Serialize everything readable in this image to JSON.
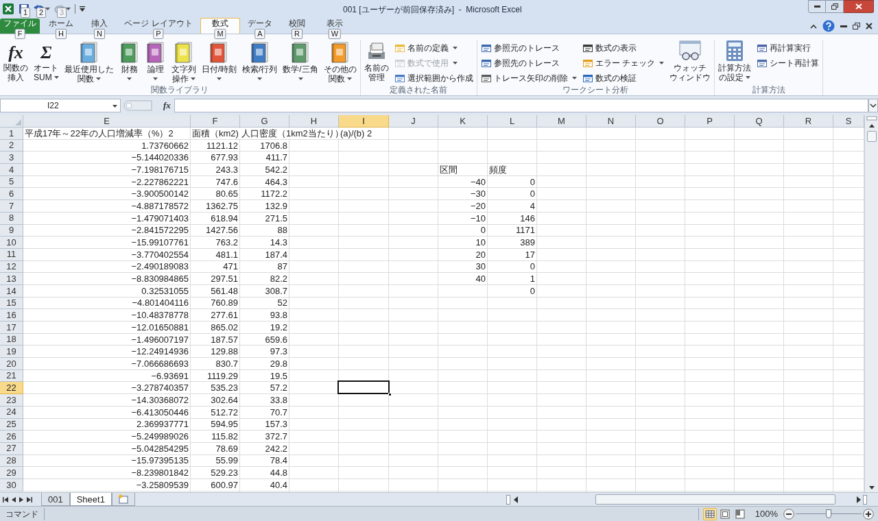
{
  "window": {
    "title": "001 [ユーザーが前回保存済み]  -  Microsoft Excel"
  },
  "quick_access_keytips": [
    "1",
    "2",
    "3"
  ],
  "tabs": [
    {
      "label": "ファイル",
      "keytip": "F",
      "kind": "file",
      "selected": false
    },
    {
      "label": "ホーム",
      "keytip": "H",
      "kind": "tab",
      "selected": false
    },
    {
      "label": "挿入",
      "keytip": "N",
      "kind": "tab",
      "selected": false
    },
    {
      "label": "ページ レイアウト",
      "keytip": "P",
      "kind": "tab",
      "selected": false
    },
    {
      "label": "数式",
      "keytip": "M",
      "kind": "tab",
      "selected": true
    },
    {
      "label": "データ",
      "keytip": "A",
      "kind": "tab",
      "selected": false
    },
    {
      "label": "校閲",
      "keytip": "R",
      "kind": "tab",
      "selected": false
    },
    {
      "label": "表示",
      "keytip": "W",
      "kind": "tab",
      "selected": false
    }
  ],
  "ribbon_groups": [
    {
      "label": "関数ライブラリ",
      "items": [
        {
          "kind": "large",
          "glyph": "fx",
          "label": [
            "関数の",
            "挿入"
          ],
          "dropdown": false
        },
        {
          "kind": "large",
          "glyph": "Σ",
          "label": [
            "オート",
            "SUM"
          ],
          "dropdown": true
        },
        {
          "kind": "large",
          "label": [
            "最近使用した",
            "関数"
          ],
          "dropdown": true
        },
        {
          "kind": "large",
          "label": [
            "財務"
          ],
          "dropdown": true
        },
        {
          "kind": "large",
          "label": [
            "論理"
          ],
          "dropdown": true
        },
        {
          "kind": "large",
          "label": [
            "文字列",
            "操作"
          ],
          "dropdown": true
        },
        {
          "kind": "large",
          "label": [
            "日付/時刻"
          ],
          "dropdown": true
        },
        {
          "kind": "large",
          "label": [
            "検索/行列"
          ],
          "dropdown": true
        },
        {
          "kind": "large",
          "label": [
            "数学/三角"
          ],
          "dropdown": true
        },
        {
          "kind": "large",
          "label": [
            "その他の",
            "関数"
          ],
          "dropdown": true
        }
      ]
    },
    {
      "label": "定義された名前",
      "items": [
        {
          "kind": "large",
          "label": [
            "名前の",
            "管理"
          ],
          "dropdown": false
        },
        {
          "kind": "small_stack",
          "items": [
            {
              "label": "名前の定義",
              "dropdown": true,
              "disabled": false
            },
            {
              "label": "数式で使用",
              "dropdown": true,
              "disabled": true
            },
            {
              "label": "選択範囲から作成",
              "dropdown": false,
              "disabled": false
            }
          ]
        }
      ]
    },
    {
      "label": "ワークシート分析",
      "items": [
        {
          "kind": "small_stack",
          "items": [
            {
              "label": "参照元のトレース",
              "dropdown": false,
              "disabled": false
            },
            {
              "label": "参照先のトレース",
              "dropdown": false,
              "disabled": false
            },
            {
              "label": "トレース矢印の削除",
              "dropdown": true,
              "disabled": false
            }
          ]
        },
        {
          "kind": "small_stack",
          "items": [
            {
              "label": "数式の表示",
              "dropdown": false,
              "disabled": false
            },
            {
              "label": "エラー チェック",
              "dropdown": true,
              "disabled": false
            },
            {
              "label": "数式の検証",
              "dropdown": false,
              "disabled": false
            }
          ]
        },
        {
          "kind": "large",
          "label": [
            "ウォッチ",
            "ウィンドウ"
          ],
          "dropdown": false
        }
      ]
    },
    {
      "label": "計算方法",
      "items": [
        {
          "kind": "large",
          "label": [
            "計算方法",
            "の設定"
          ],
          "dropdown": true
        },
        {
          "kind": "small_stack",
          "items": [
            {
              "label": "再計算実行",
              "dropdown": false,
              "disabled": false
            },
            {
              "label": "シート再計算",
              "dropdown": false,
              "disabled": false
            }
          ]
        }
      ]
    }
  ],
  "name_box": {
    "value": "I22"
  },
  "formula_bar": {
    "fx": "fx"
  },
  "columns": [
    {
      "label": "E",
      "selected": false
    },
    {
      "label": "F",
      "selected": false
    },
    {
      "label": "G",
      "selected": false
    },
    {
      "label": "H",
      "selected": false
    },
    {
      "label": "I",
      "selected": true
    },
    {
      "label": "J",
      "selected": false
    },
    {
      "label": "K",
      "selected": false
    },
    {
      "label": "L",
      "selected": false
    },
    {
      "label": "M",
      "selected": false
    },
    {
      "label": "N",
      "selected": false
    },
    {
      "label": "O",
      "selected": false
    },
    {
      "label": "P",
      "selected": false
    },
    {
      "label": "Q",
      "selected": false
    },
    {
      "label": "R",
      "selected": false
    },
    {
      "label": "S",
      "selected": false
    }
  ],
  "rows": [
    {
      "number": "1",
      "selected": false,
      "e": {
        "text": "平成17年～22年の人口増減率（%）2",
        "kind": "label"
      },
      "f": {
        "text": "面積（km2)",
        "kind": "label"
      },
      "g": {
        "text": "人口密度（1km2当たり）",
        "kind": "label"
      },
      "i": {
        "text": "(a)/(b) 2",
        "kind": "label"
      }
    },
    {
      "number": "2",
      "selected": false,
      "e": "1.73760662",
      "f": "1121.12",
      "g": "1706.8"
    },
    {
      "number": "3",
      "selected": false,
      "e": "−5.144020336",
      "f": "677.93",
      "g": "411.7"
    },
    {
      "number": "4",
      "selected": false,
      "e": "−7.198176715",
      "f": "243.3",
      "g": "542.2",
      "k": {
        "text": "区間",
        "kind": "label"
      },
      "l": {
        "text": "頻度",
        "kind": "label"
      }
    },
    {
      "number": "5",
      "selected": false,
      "e": "−2.227862221",
      "f": "747.6",
      "g": "464.3",
      "k": "−40",
      "l": "0"
    },
    {
      "number": "6",
      "selected": false,
      "e": "−3.900500142",
      "f": "80.65",
      "g": "1172.2",
      "k": "−30",
      "l": "0"
    },
    {
      "number": "7",
      "selected": false,
      "e": "−4.887178572",
      "f": "1362.75",
      "g": "132.9",
      "k": "−20",
      "l": "4"
    },
    {
      "number": "8",
      "selected": false,
      "e": "−1.479071403",
      "f": "618.94",
      "g": "271.5",
      "k": "−10",
      "l": "146"
    },
    {
      "number": "9",
      "selected": false,
      "e": "−2.841572295",
      "f": "1427.56",
      "g": "88",
      "k": "0",
      "l": "1171"
    },
    {
      "number": "10",
      "selected": false,
      "e": "−15.99107761",
      "f": "763.2",
      "g": "14.3",
      "k": "10",
      "l": "389"
    },
    {
      "number": "11",
      "selected": false,
      "e": "−3.770402554",
      "f": "481.1",
      "g": "187.4",
      "k": "20",
      "l": "17"
    },
    {
      "number": "12",
      "selected": false,
      "e": "−2.490189083",
      "f": "471",
      "g": "87",
      "k": "30",
      "l": "0"
    },
    {
      "number": "13",
      "selected": false,
      "e": "−8.830984865",
      "f": "297.51",
      "g": "82.2",
      "k": "40",
      "l": "1"
    },
    {
      "number": "14",
      "selected": false,
      "e": "0.32531055",
      "f": "561.48",
      "g": "308.7",
      "l": "0"
    },
    {
      "number": "15",
      "selected": false,
      "e": "−4.801404116",
      "f": "760.89",
      "g": "52"
    },
    {
      "number": "16",
      "selected": false,
      "e": "−10.48378778",
      "f": "277.61",
      "g": "93.8"
    },
    {
      "number": "17",
      "selected": false,
      "e": "−12.01650881",
      "f": "865.02",
      "g": "19.2"
    },
    {
      "number": "18",
      "selected": false,
      "e": "−1.496007197",
      "f": "187.57",
      "g": "659.6"
    },
    {
      "number": "19",
      "selected": false,
      "e": "−12.24914936",
      "f": "129.88",
      "g": "97.3"
    },
    {
      "number": "20",
      "selected": false,
      "e": "−7.066686693",
      "f": "830.7",
      "g": "29.8"
    },
    {
      "number": "21",
      "selected": false,
      "e": "−6.93691",
      "f": "1119.29",
      "g": "19.5"
    },
    {
      "number": "22",
      "selected": true,
      "e": "−3.278740357",
      "f": "535.23",
      "g": "57.2"
    },
    {
      "number": "23",
      "selected": false,
      "e": "−14.30368072",
      "f": "302.64",
      "g": "33.8"
    },
    {
      "number": "24",
      "selected": false,
      "e": "−6.413050446",
      "f": "512.72",
      "g": "70.7"
    },
    {
      "number": "25",
      "selected": false,
      "e": "2.369937771",
      "f": "594.95",
      "g": "157.3"
    },
    {
      "number": "26",
      "selected": false,
      "e": "−5.249989026",
      "f": "115.82",
      "g": "372.7"
    },
    {
      "number": "27",
      "selected": false,
      "e": "−5.042854295",
      "f": "78.69",
      "g": "242.2"
    },
    {
      "number": "28",
      "selected": false,
      "e": "−15.97395135",
      "f": "55.99",
      "g": "78.4"
    },
    {
      "number": "29",
      "selected": false,
      "e": "−8.239801842",
      "f": "529.23",
      "g": "44.8"
    },
    {
      "number": "30",
      "selected": false,
      "e": "−3.25809539",
      "f": "600.97",
      "g": "40.4"
    }
  ],
  "sheet_tabs": [
    {
      "label": "001",
      "selected": false
    },
    {
      "label": "Sheet1",
      "selected": true
    }
  ],
  "status_bar": {
    "mode": "コマンド",
    "view_buttons": [
      {
        "selected": true
      },
      {
        "selected": false
      },
      {
        "selected": false
      }
    ],
    "zoom": {
      "text": "100%",
      "level": 0.5
    }
  }
}
